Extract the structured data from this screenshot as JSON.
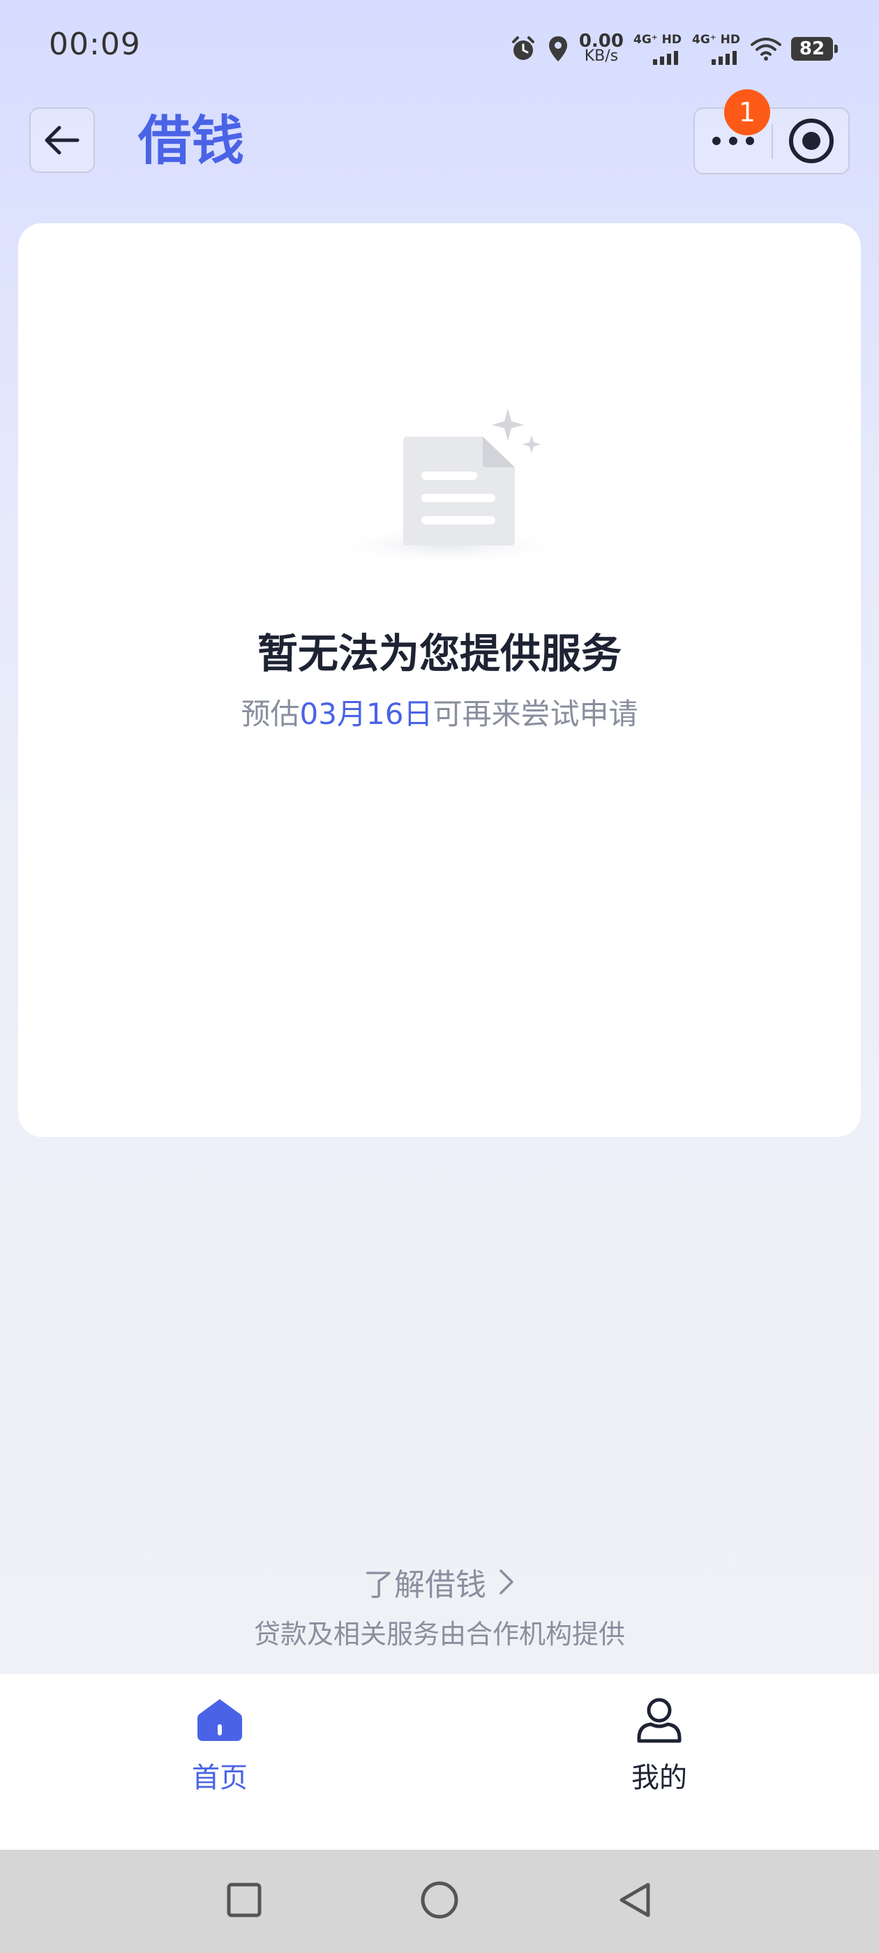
{
  "status_bar": {
    "time": "00:09",
    "net_speed_value": "0.00",
    "net_speed_unit": "KB/s",
    "signal1_label": "4G⁺ HD",
    "signal2_label": "4G⁺ HD",
    "battery": "82",
    "icons": [
      "alarm-icon",
      "location-icon",
      "wifi-icon",
      "battery-icon"
    ]
  },
  "header": {
    "title": "借钱",
    "badge_count": "1",
    "accent_color": "#4a63e6",
    "badge_color": "#fe5a17"
  },
  "empty_state": {
    "title": "暂无法为您提供服务",
    "subtitle_prefix": "预估",
    "subtitle_date": "03月16日",
    "subtitle_suffix": "可再来尝试申请"
  },
  "footer": {
    "learn_more": "了解借钱",
    "disclaimer": "贷款及相关服务由合作机构提供"
  },
  "tabbar": {
    "items": [
      {
        "label": "首页",
        "icon": "home-icon",
        "active": true
      },
      {
        "label": "我的",
        "icon": "user-icon",
        "active": false
      }
    ]
  },
  "navbar": {
    "icons": [
      "recent-apps-icon",
      "home-circle-icon",
      "back-triangle-icon"
    ]
  }
}
